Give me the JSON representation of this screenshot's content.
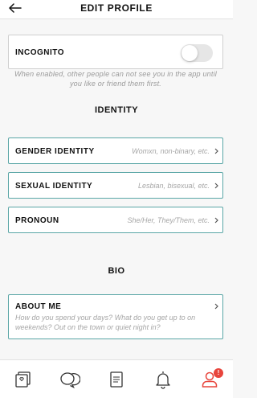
{
  "header": {
    "title": "EDIT PROFILE",
    "back_icon": "arrow-left-icon"
  },
  "incognito": {
    "label": "INCOGNITO",
    "enabled": false,
    "hint": "When enabled, other people can not see you in the app until you like or friend them first."
  },
  "identity": {
    "title": "IDENTITY",
    "rows": [
      {
        "label": "GENDER IDENTITY",
        "placeholder": "Womxn, non-binary, etc."
      },
      {
        "label": "SEXUAL IDENTITY",
        "placeholder": "Lesbian, bisexual, etc."
      },
      {
        "label": "PRONOUN",
        "placeholder": "She/Her, They/Them, etc."
      }
    ]
  },
  "bio": {
    "title": "BIO",
    "about_label": "ABOUT ME",
    "about_placeholder": "How do you spend your days? What do you get up to on weekends? Out on the town or quiet night in?"
  },
  "tabbar": {
    "tabs": [
      {
        "icon": "cards-icon"
      },
      {
        "icon": "chat-bubbles-icon"
      },
      {
        "icon": "document-icon"
      },
      {
        "icon": "bell-icon"
      },
      {
        "icon": "profile-icon",
        "badge": "!",
        "active": true
      }
    ]
  },
  "colors": {
    "accent": "#e8453c",
    "card_border_active": "#5aa6a6",
    "background": "#f7f7f7"
  }
}
